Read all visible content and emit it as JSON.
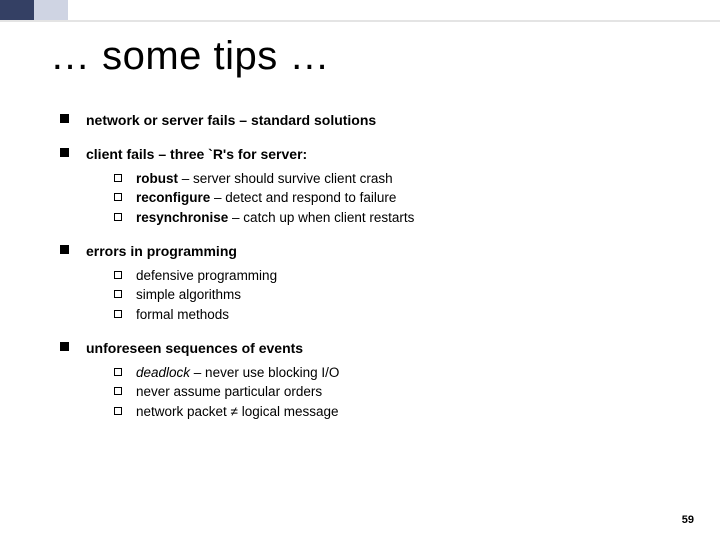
{
  "title": "… some tips …",
  "bullets": [
    {
      "text": "network or server fails – standard solutions"
    },
    {
      "text": "client fails – three `R's for server:",
      "sub": [
        {
          "bold": "robust",
          "rest": " – server should survive client crash"
        },
        {
          "bold": "reconfigure",
          "rest": " – detect and respond to failure"
        },
        {
          "bold": "resynchronise",
          "rest": " – catch up when client restarts"
        }
      ]
    },
    {
      "text": "errors in programming",
      "sub": [
        {
          "rest": "defensive programming"
        },
        {
          "rest": "simple algorithms"
        },
        {
          "rest": "formal methods"
        }
      ]
    },
    {
      "text": "unforeseen sequences of events",
      "sub": [
        {
          "italic": "deadlock",
          "rest": " – never use blocking I/O"
        },
        {
          "rest": "never assume particular orders"
        },
        {
          "rest": "network packet ≠ logical message"
        }
      ]
    }
  ],
  "slide_number": "59"
}
